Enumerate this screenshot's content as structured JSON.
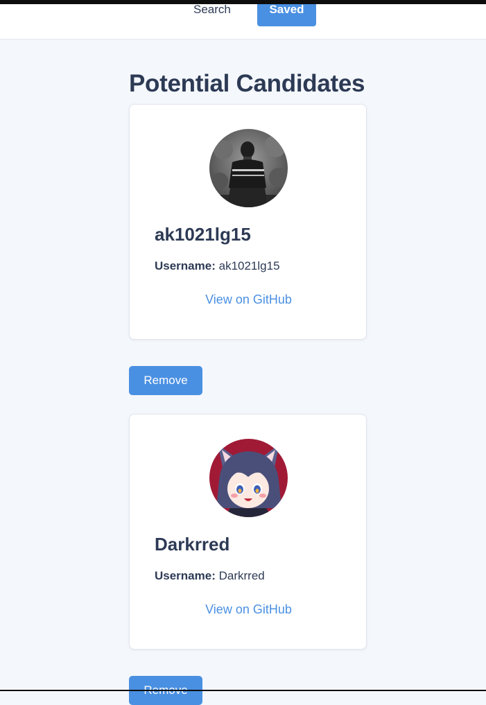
{
  "nav": {
    "search_label": "Search",
    "saved_label": "Saved"
  },
  "page": {
    "title": "Potential Candidates"
  },
  "candidates": [
    {
      "name": "ak1021lg15",
      "username_label": "Username:",
      "username": "ak1021lg15",
      "link_label": "View on GitHub",
      "remove_label": "Remove"
    },
    {
      "name": "Darkrred",
      "username_label": "Username:",
      "username": "Darkrred",
      "link_label": "View on GitHub",
      "remove_label": "Remove"
    }
  ],
  "colors": {
    "accent": "#4a90e2",
    "text": "#2d3a55",
    "background": "#f4f7fb"
  }
}
